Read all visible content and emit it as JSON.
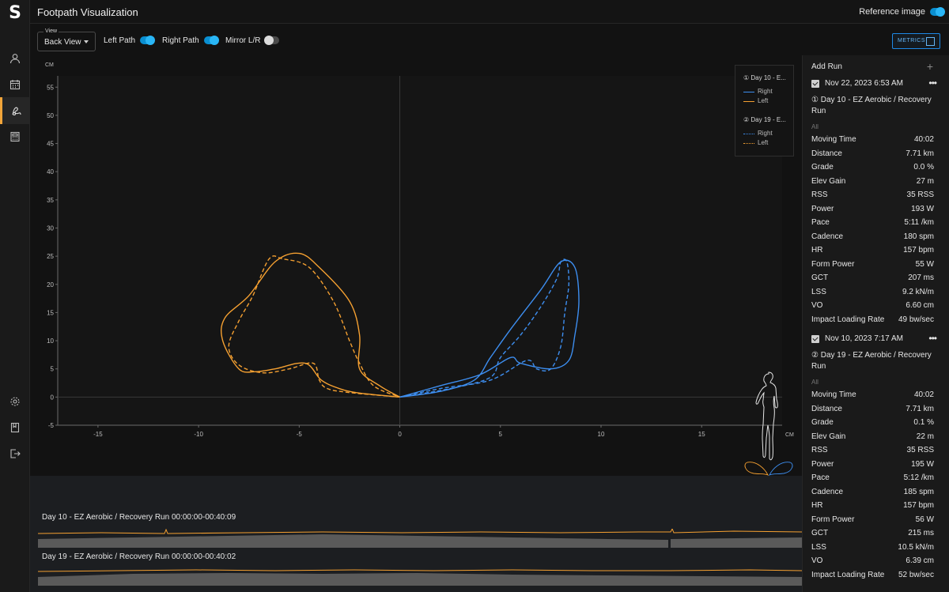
{
  "app": {
    "logo": "S",
    "title": "Footpath Visualization",
    "reference_image_label": "Reference image"
  },
  "nav": [
    "user-icon",
    "calendar-icon",
    "footpath-icon",
    "calculator-icon",
    "settings-icon",
    "book-icon",
    "logout-icon"
  ],
  "controls": {
    "view_label": "View",
    "view_value": "Back View",
    "left_path_label": "Left Path",
    "right_path_label": "Right Path",
    "mirror_label": "Mirror L/R",
    "metrics_label": "METRICS"
  },
  "colors": {
    "right": "#3d8ef0",
    "left": "#f5a031",
    "accent": "#f2a53a"
  },
  "chart_data": {
    "type": "line",
    "xlabel": "CM",
    "ylabel": "CM",
    "xlim": [
      -17,
      19
    ],
    "ylim": [
      -5,
      57
    ],
    "xticks": [
      -15,
      -10,
      -5,
      0,
      5,
      10,
      15
    ],
    "yticks": [
      -5,
      0,
      5,
      10,
      15,
      20,
      25,
      30,
      35,
      40,
      45,
      50,
      55
    ],
    "legend": [
      {
        "group": "① Day 10 - E...",
        "items": [
          {
            "name": "Right",
            "style": "solid",
            "color": "#3d8ef0"
          },
          {
            "name": "Left",
            "style": "solid",
            "color": "#f5a031"
          }
        ]
      },
      {
        "group": "② Day 19 - E...",
        "items": [
          {
            "name": "Right",
            "style": "dotted",
            "color": "#3d8ef0"
          },
          {
            "name": "Left",
            "style": "dotted",
            "color": "#f5a031"
          }
        ]
      }
    ],
    "series": [
      {
        "name": "Right",
        "run": 1,
        "dash": false,
        "color": "#3d8ef0",
        "points": [
          [
            0,
            0
          ],
          [
            2,
            1
          ],
          [
            3.7,
            3
          ],
          [
            4.5,
            7
          ],
          [
            5.5,
            12
          ],
          [
            7,
            19
          ],
          [
            8,
            24
          ],
          [
            8.7,
            23
          ],
          [
            8.9,
            17
          ],
          [
            8.7,
            11
          ],
          [
            8.4,
            6.5
          ],
          [
            7.5,
            5
          ],
          [
            6,
            6
          ],
          [
            5.5,
            7
          ],
          [
            4,
            4
          ],
          [
            2,
            2
          ],
          [
            0,
            0
          ]
        ]
      },
      {
        "name": "Left",
        "run": 1,
        "dash": false,
        "color": "#f5a031",
        "points": [
          [
            0,
            0
          ],
          [
            -2,
            0.7
          ],
          [
            -3,
            1.5
          ],
          [
            -3.9,
            3
          ],
          [
            -4.7,
            6
          ],
          [
            -6.2,
            5
          ],
          [
            -7.2,
            4.5
          ],
          [
            -8,
            5
          ],
          [
            -8.8,
            10
          ],
          [
            -8.7,
            14
          ],
          [
            -7.5,
            18
          ],
          [
            -6.2,
            24
          ],
          [
            -5,
            25.5
          ],
          [
            -4,
            23
          ],
          [
            -2.5,
            17
          ],
          [
            -2,
            11
          ],
          [
            -2,
            5
          ],
          [
            -1,
            2
          ],
          [
            0,
            0
          ]
        ]
      },
      {
        "name": "Right",
        "run": 2,
        "dash": true,
        "color": "#3d8ef0",
        "points": [
          [
            0,
            0
          ],
          [
            2.5,
            1.5
          ],
          [
            4.5,
            3.5
          ],
          [
            5,
            7
          ],
          [
            6,
            11
          ],
          [
            7,
            16
          ],
          [
            7.8,
            21
          ],
          [
            8,
            24
          ],
          [
            8.3,
            24
          ],
          [
            8.4,
            20
          ],
          [
            8.2,
            15
          ],
          [
            8,
            9
          ],
          [
            7.5,
            5
          ],
          [
            6.8,
            5
          ],
          [
            6.3,
            6.5
          ],
          [
            4.5,
            3
          ],
          [
            2,
            1.5
          ],
          [
            0,
            0
          ]
        ]
      },
      {
        "name": "Left",
        "run": 2,
        "dash": true,
        "color": "#f5a031",
        "points": [
          [
            0,
            0
          ],
          [
            -2.5,
            0.8
          ],
          [
            -3.6,
            1.5
          ],
          [
            -4,
            3
          ],
          [
            -4.3,
            6
          ],
          [
            -5.5,
            5
          ],
          [
            -6.8,
            4.3
          ],
          [
            -8,
            5.7
          ],
          [
            -8.5,
            9
          ],
          [
            -8,
            13.5
          ],
          [
            -7.3,
            18
          ],
          [
            -6.5,
            24.5
          ],
          [
            -5.8,
            24.5
          ],
          [
            -4.5,
            23
          ],
          [
            -3.3,
            17
          ],
          [
            -2.5,
            10
          ],
          [
            -2,
            6
          ],
          [
            -1.3,
            2
          ],
          [
            0,
            0
          ]
        ]
      }
    ]
  },
  "runs": [
    {
      "date": "Nov 22, 2023 6:53 AM",
      "name": "① Day 10 - EZ Aerobic / Recovery Run",
      "filter": "All",
      "metrics": [
        {
          "k": "Moving Time",
          "v": "40:02"
        },
        {
          "k": "Distance",
          "v": "7.71 km"
        },
        {
          "k": "Grade",
          "v": "0.0 %"
        },
        {
          "k": "Elev Gain",
          "v": "27 m"
        },
        {
          "k": "RSS",
          "v": "35 RSS"
        },
        {
          "k": "Power",
          "v": "193 W"
        },
        {
          "k": "Pace",
          "v": "5:11 /km"
        },
        {
          "k": "Cadence",
          "v": "180 spm"
        },
        {
          "k": "HR",
          "v": "157 bpm"
        },
        {
          "k": "Form Power",
          "v": "55 W"
        },
        {
          "k": "GCT",
          "v": "207 ms"
        },
        {
          "k": "LSS",
          "v": "9.2 kN/m"
        },
        {
          "k": "VO",
          "v": "6.60 cm"
        },
        {
          "k": "Impact Loading Rate",
          "v": "49 bw/sec"
        }
      ]
    },
    {
      "date": "Nov 10, 2023 7:17 AM",
      "name": "② Day 19 - EZ Aerobic / Recovery Run",
      "filter": "All",
      "metrics": [
        {
          "k": "Moving Time",
          "v": "40:02"
        },
        {
          "k": "Distance",
          "v": "7.71 km"
        },
        {
          "k": "Grade",
          "v": "0.1 %"
        },
        {
          "k": "Elev Gain",
          "v": "22 m"
        },
        {
          "k": "RSS",
          "v": "35 RSS"
        },
        {
          "k": "Power",
          "v": "195 W"
        },
        {
          "k": "Pace",
          "v": "5:12 /km"
        },
        {
          "k": "Cadence",
          "v": "185 spm"
        },
        {
          "k": "HR",
          "v": "157 bpm"
        },
        {
          "k": "Form Power",
          "v": "56 W"
        },
        {
          "k": "GCT",
          "v": "215 ms"
        },
        {
          "k": "LSS",
          "v": "10.5 kN/m"
        },
        {
          "k": "VO",
          "v": "6.39 cm"
        },
        {
          "k": "Impact Loading Rate",
          "v": "52 bw/sec"
        }
      ]
    }
  ],
  "panel": {
    "add_run_label": "Add Run"
  },
  "timeline": [
    {
      "label": "Day 10 - EZ Aerobic / Recovery Run  00:00:00-00:40:09"
    },
    {
      "label": "Day 19 - EZ Aerobic / Recovery Run  00:00:00-00:40:02"
    }
  ]
}
